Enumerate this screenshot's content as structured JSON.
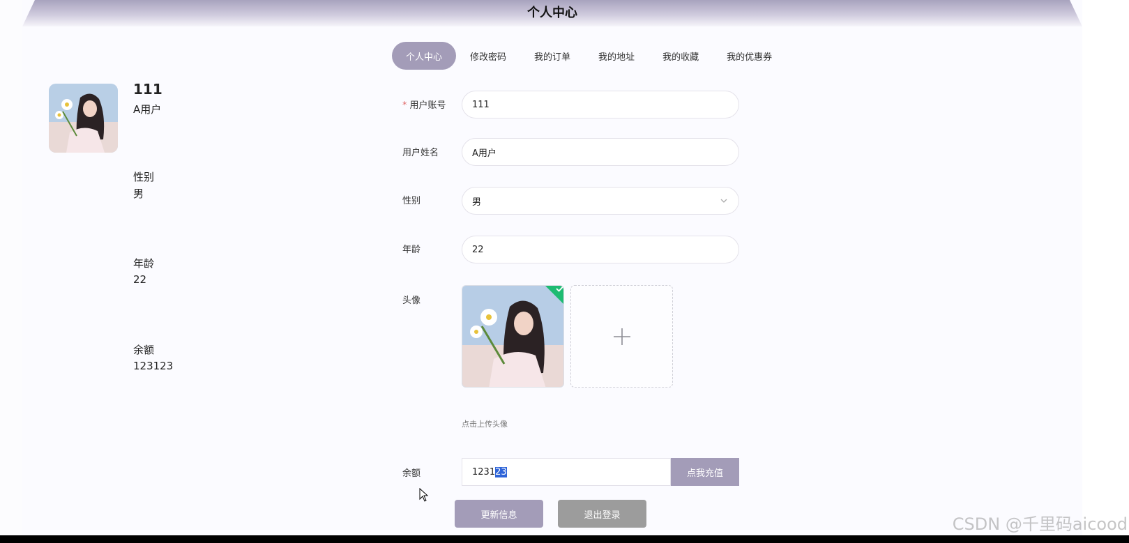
{
  "header": {
    "title": "个人中心"
  },
  "tabs": [
    {
      "label": "个人中心",
      "active": true
    },
    {
      "label": "修改密码",
      "active": false
    },
    {
      "label": "我的订单",
      "active": false
    },
    {
      "label": "我的地址",
      "active": false
    },
    {
      "label": "我的收藏",
      "active": false
    },
    {
      "label": "我的优惠券",
      "active": false
    }
  ],
  "profile": {
    "account": "111",
    "name": "A用户",
    "gender_label": "性别",
    "gender": "男",
    "age_label": "年龄",
    "age": "22",
    "balance_label": "余额",
    "balance": "123123"
  },
  "form": {
    "account_label": "用户账号",
    "required_mark": "*",
    "account_value": "111",
    "name_label": "用户姓名",
    "name_value": "A用户",
    "gender_label": "性别",
    "gender_value": "男",
    "age_label": "年龄",
    "age_value": "22",
    "avatar_label": "头像",
    "upload_tip": "点击上传头像",
    "balance_label": "余额",
    "balance_value_plain": "1231",
    "balance_value_selected": "23",
    "recharge_label": "点我充值",
    "update_label": "更新信息",
    "logout_label": "退出登录"
  },
  "watermark": "CSDN @千里码aicood",
  "colors": {
    "accent": "#a39cb8",
    "success": "#1dbb72",
    "selection": "#2e64d8"
  }
}
